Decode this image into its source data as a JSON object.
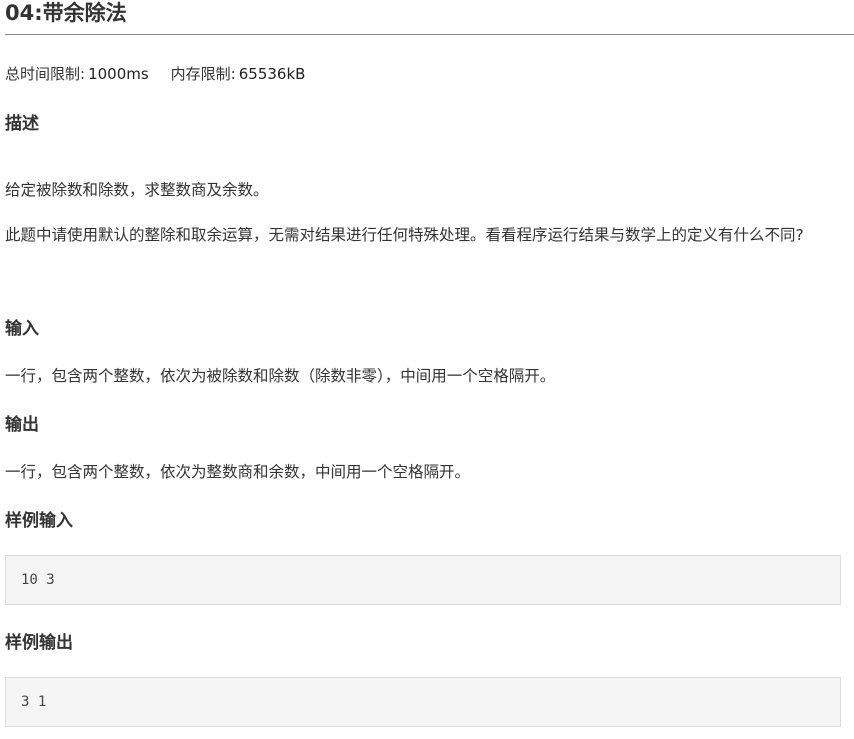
{
  "problem": {
    "title": "04:带余除法",
    "limits": {
      "time_label": "总时间限制:",
      "time_value": "1000ms",
      "memory_label": "内存限制:",
      "memory_value": "65536kB"
    },
    "description": {
      "heading": "描述",
      "paragraph_1": "给定被除数和除数，求整数商及余数。",
      "paragraph_2": "此题中请使用默认的整除和取余运算，无需对结果进行任何特殊处理。看看程序运行结果与数学上的定义有什么不同?"
    },
    "input": {
      "heading": "输入",
      "text": "一行，包含两个整数，依次为被除数和除数（除数非零），中间用一个空格隔开。"
    },
    "output": {
      "heading": "输出",
      "text": "一行，包含两个整数，依次为整数商和余数，中间用一个空格隔开。"
    },
    "sample_input": {
      "heading": "样例输入",
      "content": "10 3"
    },
    "sample_output": {
      "heading": "样例输出",
      "content": "3 1"
    }
  }
}
